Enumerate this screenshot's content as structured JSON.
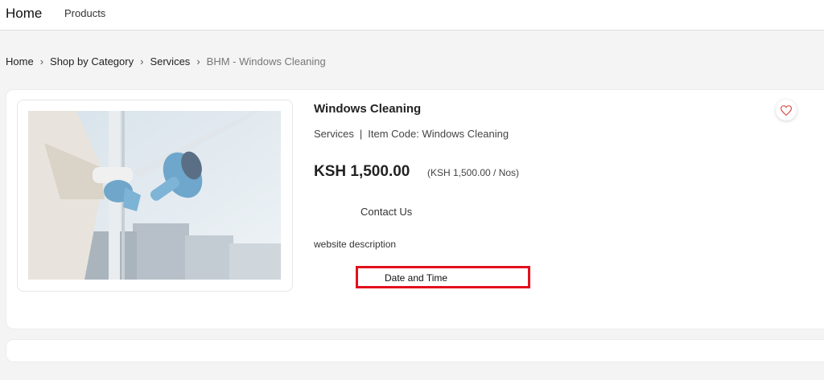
{
  "nav": {
    "brand": "Home",
    "products": "Products"
  },
  "breadcrumb": {
    "items": [
      "Home",
      "Shop by Category",
      "Services",
      "BHM - Windows Cleaning"
    ],
    "separator": "›"
  },
  "product": {
    "name": "Windows Cleaning",
    "category": "Services",
    "item_code": "Item Code: Windows Cleaning",
    "price": "KSH 1,500.00",
    "unit_price": "(KSH 1,500.00 / Nos)",
    "contact_label": "Contact Us",
    "description": "website description",
    "datetime_label": "Date and Time",
    "image_icon": "window-cleaning-photo"
  },
  "colors": {
    "highlight": "#e3101c",
    "wishlist": "#d9534f"
  }
}
